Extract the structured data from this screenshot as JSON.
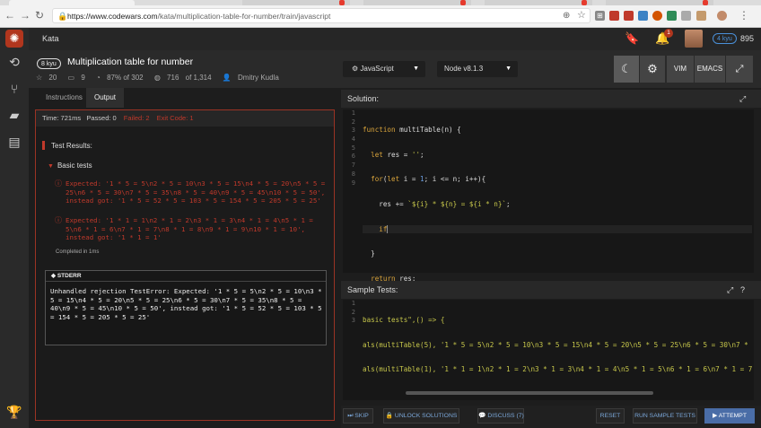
{
  "browser": {
    "url_prefix": "https://www.codewars.com",
    "url_path": "/kata/multiplication-table-for-number/train/javascript"
  },
  "topbar": {
    "section": "Kata",
    "notification_count": "1",
    "rank": "4 kyu",
    "honor": "895"
  },
  "kata": {
    "kyu": "8 kyu",
    "title": "Multiplication table for number",
    "stars": "20",
    "bookmarks": "9",
    "satisfaction": "87% of 302",
    "completions_a": "716",
    "completions_b": "of 1,314",
    "author": "Dmitry Kudla"
  },
  "controls": {
    "language": "JavaScript",
    "version": "Node v8.1.3",
    "vim": "VIM",
    "emacs": "EMACS"
  },
  "output": {
    "tabs": [
      "Instructions",
      "Output"
    ],
    "time": "Time: 721ms",
    "passed": "Passed: 0",
    "failed": "Failed: 2",
    "exit_code": "Exit Code: 1",
    "results_title": "Test Results:",
    "group": "Basic tests",
    "error1": "Expected: '1 * 5 = 5\\n2 * 5 = 10\\n3 * 5 = 15\\n4 * 5 = 20\\n5 * 5 = 25\\n6 * 5 = 30\\n7 * 5 = 35\\n8 * 5 = 40\\n9 * 5 = 45\\n10 * 5 = 50', instead got: '1 * 5 = 52 * 5 = 103 * 5 = 154 * 5 = 205 * 5 = 25'",
    "error2": "Expected: '1 * 1 = 1\\n2 * 1 = 2\\n3 * 1 = 3\\n4 * 1 = 4\\n5 * 1 = 5\\n6 * 1 = 6\\n7 * 1 = 7\\n8 * 1 = 8\\n9 * 1 = 9\\n10 * 1 = 10', instead got: '1 * 1 = 1'",
    "completed": "Completed in 1ms",
    "stderr_title": "STDERR",
    "stderr_text": "Unhandled rejection TestError: Expected: '1 * 5 = 5\\n2 * 5 = 10\\n3 * 5 = 15\\n4 * 5 = 20\\n5 * 5 = 25\\n6 * 5 = 30\\n7 * 5 = 35\\n8 * 5 = 40\\n9 * 5 = 45\\n10 * 5 = 50', instead got: '1 * 5 = 52 * 5 = 103 * 5 = 154 * 5 = 205 * 5 = 25'"
  },
  "solution": {
    "title": "Solution:",
    "line_numbers": [
      "1",
      "2",
      "3",
      "4",
      "5",
      "6",
      "7",
      "8",
      "9"
    ]
  },
  "sample_tests": {
    "title": "Sample Tests:",
    "line_numbers": [
      "1",
      "2",
      "3"
    ],
    "line1": "basic tests\",() => {",
    "line2": "als(multiTable(5), '1 * 5 = 5\\n2 * 5 = 10\\n3 * 5 = 15\\n4 * 5 = 20\\n5 * 5 = 25\\n6 * 5 = 30\\n7 * 5 = 35\\",
    "line3": "als(multiTable(1), '1 * 1 = 1\\n2 * 1 = 2\\n3 * 1 = 3\\n4 * 1 = 4\\n5 * 1 = 5\\n6 * 1 = 6\\n7 * 1 = 7\\n8 * 1"
  },
  "actions": {
    "skip": "SKIP",
    "unlock": "UNLOCK SOLUTIONS",
    "discuss": "DISCUSS (7)",
    "reset": "RESET",
    "sample": "RUN SAMPLE TESTS",
    "attempt": "ATTEMPT"
  },
  "colors": {
    "accent_red": "#b1361e",
    "fail_red": "#c0392b",
    "link_blue": "#7ba7d9",
    "attempt_blue": "#4a6da7"
  }
}
